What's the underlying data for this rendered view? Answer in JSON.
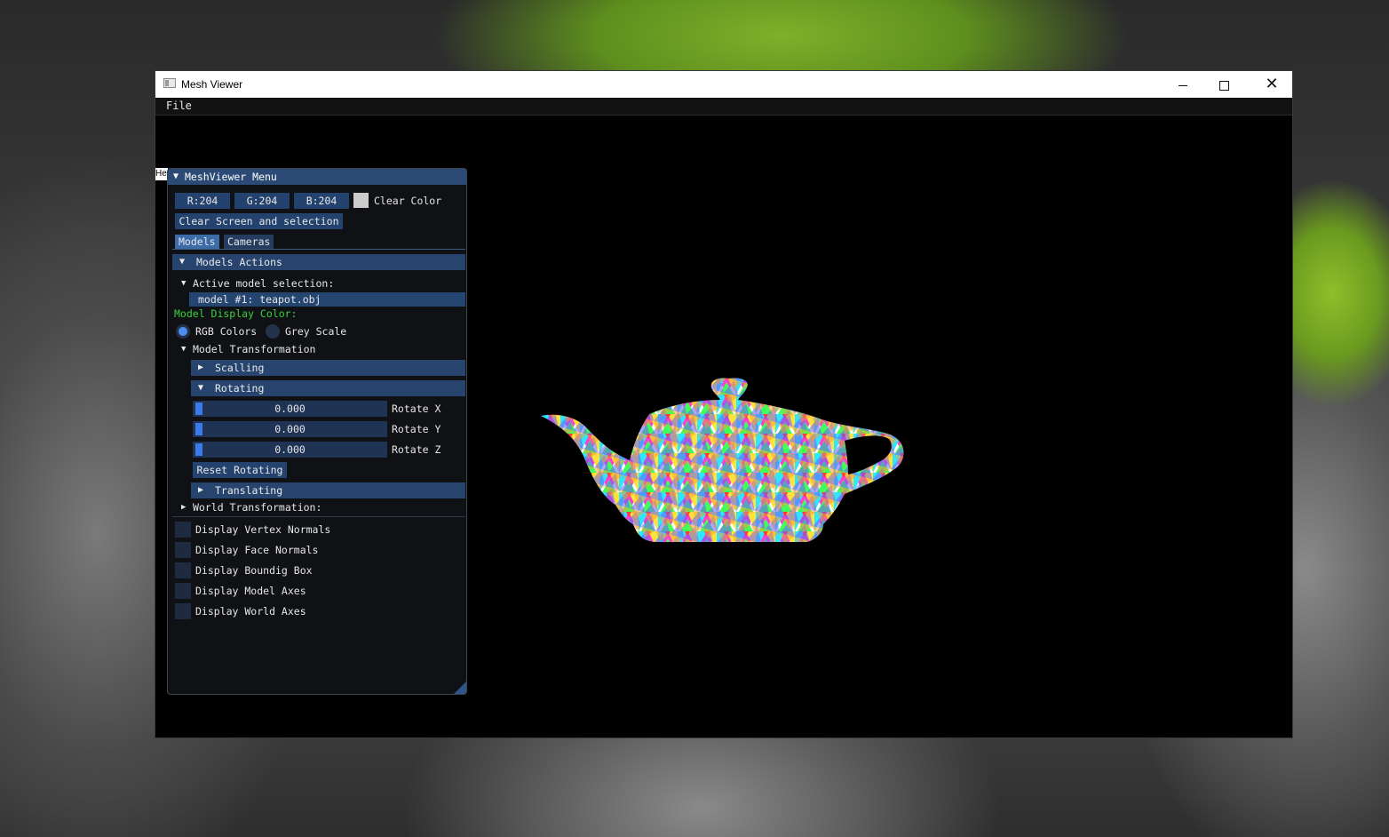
{
  "window": {
    "title": "Mesh Viewer",
    "controls": {
      "minimize": "—",
      "maximize": "□",
      "close": "✕"
    }
  },
  "menubar": {
    "file": "File"
  },
  "hidden_tab": "He",
  "panel": {
    "title": "MeshViewer Menu",
    "color_buttons": {
      "r": "R:204",
      "g": "G:204",
      "b": "B:204"
    },
    "clear_color_label": "Clear Color",
    "clear_color_value": "#cccccc",
    "clear_screen_button": "Clear Screen and selection",
    "tabs": [
      {
        "label": "Models",
        "active": true
      },
      {
        "label": "Cameras",
        "active": false
      }
    ],
    "models_actions_header": "Models Actions",
    "active_model_label": "Active model selection:",
    "active_model_item": "model #1: teapot.obj",
    "display_color_label": "Model Display Color:",
    "radio": {
      "rgb": "RGB Colors",
      "grey": "Grey Scale",
      "selected": "rgb"
    },
    "model_transformation_label": "Model Transformation",
    "scaling_header": "Scalling",
    "rotating_header": "Rotating",
    "sliders": [
      {
        "value": "0.000",
        "label": "Rotate X"
      },
      {
        "value": "0.000",
        "label": "Rotate Y"
      },
      {
        "value": "0.000",
        "label": "Rotate Z"
      }
    ],
    "reset_rotating_button": "Reset Rotating",
    "translating_header": "Translating",
    "world_transformation_label": "World Transformation:",
    "checkboxes": [
      {
        "label": "Display Vertex Normals",
        "checked": false
      },
      {
        "label": "Display Face Normals",
        "checked": false
      },
      {
        "label": "Display Boundig Box",
        "checked": false
      },
      {
        "label": "Display Model Axes",
        "checked": false
      },
      {
        "label": "Display World Axes",
        "checked": false
      }
    ]
  },
  "colors": {
    "panel_header": "#2b4a75",
    "accent": "#3c7ae6",
    "label_green": "#3dd13d"
  }
}
